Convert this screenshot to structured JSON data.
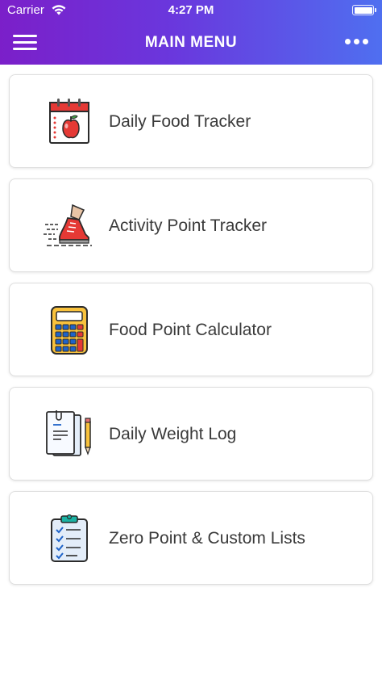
{
  "status_bar": {
    "carrier": "Carrier",
    "time": "4:27 PM"
  },
  "nav": {
    "title": "MAIN MENU",
    "menu_icon": "hamburger-menu-icon",
    "more_icon": "more-dots-icon"
  },
  "menu_items": [
    {
      "label": "Daily Food Tracker",
      "icon": "calendar-apple-icon"
    },
    {
      "label": "Activity Point Tracker",
      "icon": "running-shoe-icon"
    },
    {
      "label": "Food Point Calculator",
      "icon": "calculator-icon"
    },
    {
      "label": "Daily Weight Log",
      "icon": "notepad-pencil-icon"
    },
    {
      "label": "Zero Point & Custom Lists",
      "icon": "clipboard-checklist-icon"
    }
  ],
  "colors": {
    "header_gradient_start": "#7b1fc9",
    "header_gradient_end": "#4f6ff0",
    "card_border": "#dedede",
    "label_text": "#3a3a3a"
  }
}
